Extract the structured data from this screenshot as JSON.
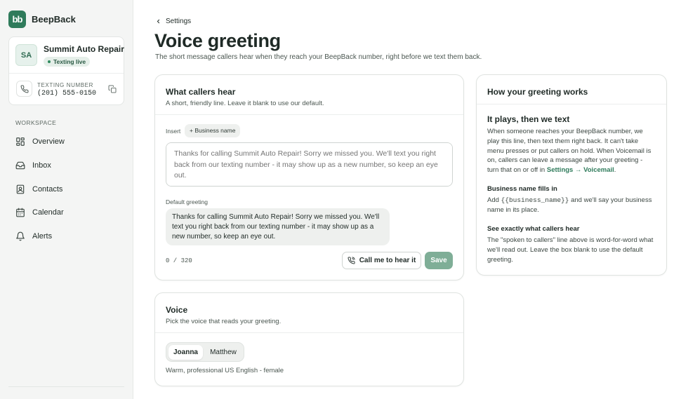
{
  "brand": {
    "logo_text": "bb",
    "name": "BeepBack"
  },
  "account": {
    "initials": "SA",
    "name": "Summit Auto Repair",
    "status": "Texting live",
    "number_label": "TEXTING NUMBER",
    "number": "(201) 555-0150"
  },
  "nav": {
    "section": "WORKSPACE",
    "items": [
      {
        "label": "Overview",
        "icon": "grid-icon"
      },
      {
        "label": "Inbox",
        "icon": "inbox-icon"
      },
      {
        "label": "Contacts",
        "icon": "contacts-icon"
      },
      {
        "label": "Calendar",
        "icon": "calendar-icon"
      },
      {
        "label": "Alerts",
        "icon": "bell-icon"
      }
    ]
  },
  "page": {
    "breadcrumb": "Settings",
    "title": "Voice greeting",
    "subtitle": "The short message callers hear when they reach your BeepBack number, right before we text them back."
  },
  "greeting_card": {
    "title": "What callers hear",
    "desc": "A short, friendly line. Leave it blank to use our default.",
    "insert_label": "Insert",
    "insert_chip": "+ Business name",
    "placeholder": "Thanks for calling Summit Auto Repair! Sorry we missed you. We'll text you right back from our texting number - it may show up as a new number, so keep an eye out.",
    "default_label": "Default greeting",
    "default_text": "Thanks for calling Summit Auto Repair! Sorry we missed you. We'll text you right back from our texting number - it may show up as a new number, so keep an eye out.",
    "char_count": "0 / 320",
    "call_button": "Call me to hear it",
    "save_button": "Save"
  },
  "voice_card": {
    "title": "Voice",
    "desc": "Pick the voice that reads your greeting.",
    "options": [
      "Joanna",
      "Matthew"
    ],
    "selected": "Joanna",
    "voice_desc": "Warm, professional US English - female"
  },
  "how_card": {
    "title": "How your greeting works",
    "s1_title": "It plays, then we text",
    "s1_text": "When someone reaches your BeepBack number, we play this line, then text them right back. It can't take menu presses or put callers on hold. When Voicemail is on, callers can leave a message after your greeting - turn that on or off in",
    "s1_link": "Settings → Voicemail",
    "s1_end": ".",
    "s2_title": "Business name fills in",
    "s2_pre": "Add",
    "s2_code": "{{business_name}}",
    "s2_post": "and we'll say your business name in its place.",
    "s3_title": "See exactly what callers hear",
    "s3_text": "The \"spoken to callers\" line above is word-for-word what we'll read out. Leave the box blank to use the default greeting."
  },
  "colors": {
    "accent": "#2f7b5b",
    "save_button": "#7fae97",
    "sidebar_bg": "#f4f5f4"
  }
}
